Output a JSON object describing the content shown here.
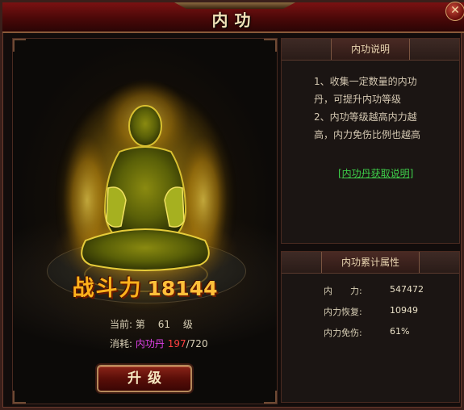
{
  "window": {
    "title": "内功",
    "close_label": "✕"
  },
  "scene": {
    "power_label": "战斗力",
    "power_value": "18144",
    "current_label": "当前:",
    "level_prefix": "第",
    "level_value": "61",
    "level_suffix": "级",
    "cost_label": "消耗:",
    "cost_item": "内功丹",
    "cost_have": "197",
    "cost_need": "/720",
    "upgrade_label": "升级"
  },
  "description": {
    "header": "内功说明",
    "lines": [
      "1、收集一定数量的内功",
      "丹，可提升内功等级",
      "2、内功等级越高内力越",
      "高，内力免伤比例也越高"
    ],
    "link": "[内功丹获取说明]"
  },
  "attributes": {
    "header": "内功累计属性",
    "rows": [
      {
        "label": "内　　力:",
        "value": "547472"
      },
      {
        "label": "内力恢复:",
        "value": "10949"
      },
      {
        "label": "内力免伤:",
        "value": "61%"
      }
    ]
  },
  "colors": {
    "power": "#ffb21c",
    "item_name": "#e040e8",
    "item_have": "#ff4040",
    "link": "#3ecf4a"
  }
}
